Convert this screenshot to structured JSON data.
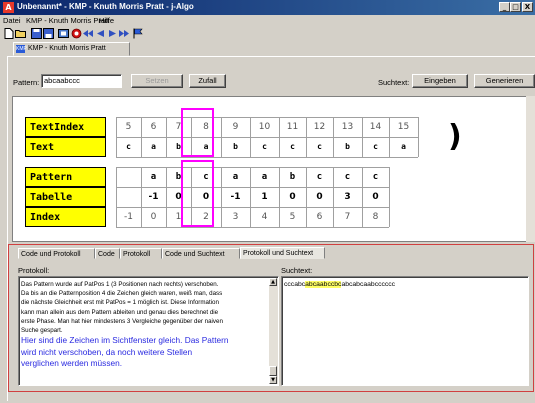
{
  "window": {
    "title": "Unbenannt* - KMP - Knuth Morris Pratt - j-Algo",
    "icon_letter": "A",
    "controls": [
      "_",
      "□",
      "X"
    ]
  },
  "menu": [
    "Datei",
    "KMP - Knuth Morris Pratt",
    "Hilfe"
  ],
  "toolbar": {
    "icons": [
      "new-file-icon",
      "open-folder-icon",
      "save-icon",
      "save-as-icon",
      "info-icon",
      "stop-icon",
      "skip-back-icon",
      "step-back-icon",
      "step-forward-icon",
      "skip-forward-icon",
      "flag-icon"
    ]
  },
  "file_tab": {
    "label": "KMP - Knuth Morris Pratt",
    "icon_text": "KMP"
  },
  "pattern_row": {
    "pattern_label": "Pattern:",
    "pattern_value": "abcaabccc",
    "setzen_label": "Setzen",
    "zufall_label": "Zufall",
    "suchtext_label": "Suchtext:",
    "eingeben_label": "Eingeben",
    "generieren_label": "Generieren"
  },
  "table": {
    "highlight_color": "#ff00ff",
    "header_color": "#ffff00",
    "top": {
      "labels": [
        "TextIndex",
        "Text"
      ],
      "text_index": [
        "5",
        "6",
        "7",
        "8",
        "9",
        "10",
        "11",
        "12",
        "13",
        "14",
        "15"
      ],
      "text": [
        "c",
        "a",
        "b",
        "a",
        "b",
        "c",
        "c",
        "c",
        "b",
        "c",
        "a"
      ]
    },
    "bottom": {
      "labels": [
        "Pattern",
        "Tabelle",
        "Index"
      ],
      "pattern": [
        "",
        "a",
        "b",
        "c",
        "a",
        "a",
        "b",
        "c",
        "c",
        "c"
      ],
      "tabelle": [
        "",
        "-1",
        "0",
        "0",
        "-1",
        "1",
        "0",
        "0",
        "3",
        "0"
      ],
      "index": [
        "-1",
        "0",
        "1",
        "2",
        "3",
        "4",
        "5",
        "6",
        "7",
        "8"
      ]
    }
  },
  "bottom_tabs": [
    {
      "label": "Code und Protokoll",
      "active": false
    },
    {
      "label": "Code",
      "active": false
    },
    {
      "label": "Protokoll",
      "active": false
    },
    {
      "label": "Code und Suchtext",
      "active": false
    },
    {
      "label": "Protokoll und Suchtext",
      "active": true
    }
  ],
  "protokoll": {
    "label": "Protokoll:",
    "lines": [
      "Das Pattern wurde auf PatPos 1 (3 Positionen  nach rechts) verschoben.",
      "Da bis an die Patternposition 4 die Zeichen gleich waren, weiß man, dass",
      "die nächste Gleichheit erst mit PatPos = 1 möglich ist. Diese Information",
      "kann man allein aus dem Pattern ableiten und genau dies berechnet die",
      "erste Phase. Man hat hier mindestens 3 Vergleiche gegenüber der naiven",
      "Suche gespart."
    ],
    "highlight_lines": [
      "Hier sind die Zeichen im Sichtfenster gleich. Das Pattern",
      "wird nicht verschoben, da noch weitere Stellen",
      "verglichen werden müssen."
    ],
    "highlight_color": "#2a2ae0"
  },
  "suchtext": {
    "label": "Suchtext:",
    "prefix": "cccabc",
    "highlighted": "abcaabccbc",
    "suffix": "abcabcaabcccccc"
  }
}
